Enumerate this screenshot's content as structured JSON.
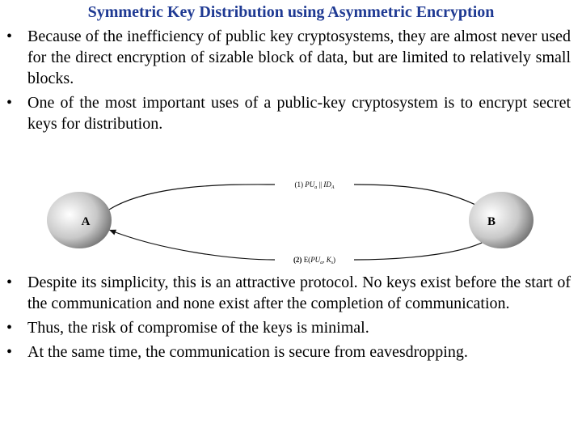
{
  "title": "Symmetric Key Distribution using Asymmetric Encryption",
  "bullets_top": [
    "Because of the inefficiency of public key cryptosystems, they are almost never used for the direct encryption of sizable block of data, but are limited to relatively small blocks.",
    "One of the most important uses of a public-key cryptosystem is to encrypt secret keys for distribution."
  ],
  "diagram": {
    "node_a": "A",
    "node_b": "B",
    "msg1": {
      "step": "(1)",
      "text": "PU",
      "sub": "a",
      "sep": " || ",
      "text2": "ID",
      "sub2": "A"
    },
    "msg2": {
      "step": "(2)",
      "prefix": "E(",
      "text": "PU",
      "sub": "a",
      "mid": ", K",
      "sub2": "s",
      "suffix": ")"
    }
  },
  "bullets_bottom": [
    "Despite its simplicity, this is an attractive protocol. No keys exist before the start of the communication and none exist after the completion of communication.",
    "Thus, the risk of compromise of the keys is minimal.",
    "At the same time, the communication is secure from eavesdropping."
  ],
  "bullet_glyph": "•"
}
